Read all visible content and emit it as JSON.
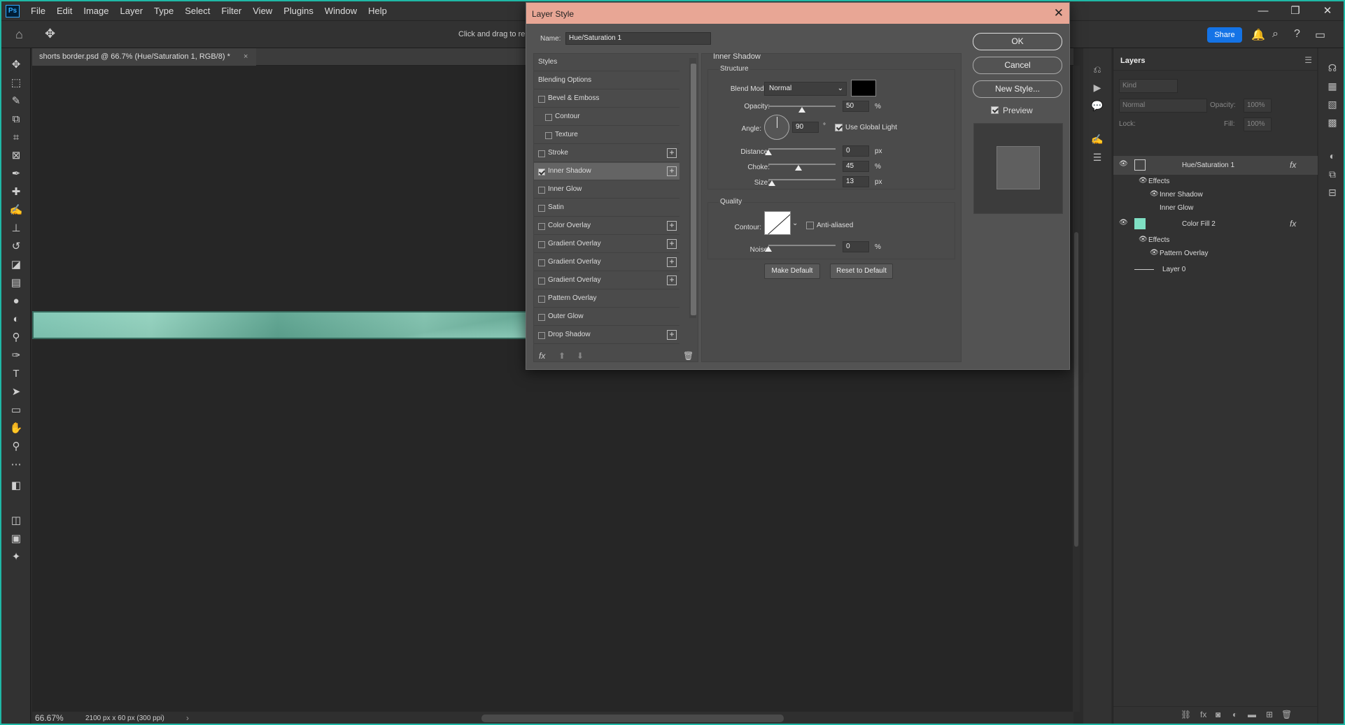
{
  "app": {
    "logo": "Ps"
  },
  "menu": [
    "File",
    "Edit",
    "Image",
    "Layer",
    "Type",
    "Select",
    "Filter",
    "View",
    "Plugins",
    "Window",
    "Help"
  ],
  "window_controls": {
    "minimize": "—",
    "restore": "❐",
    "close": "✕"
  },
  "options_bar": {
    "hint": "Click and drag to rep",
    "share": "Share"
  },
  "document": {
    "tab_title": "shorts border.psd @ 66.7% (Hue/Saturation 1, RGB/8) *",
    "zoom": "66.67%",
    "dimensions": "2100 px x 60 px (300 ppi)"
  },
  "dialog": {
    "title": "Layer Style",
    "name_label": "Name:",
    "name_value": "Hue/Saturation 1",
    "styles": [
      {
        "label": "Styles",
        "checkbox": false,
        "checked": false,
        "plus": false,
        "indent": 0,
        "selected": false
      },
      {
        "label": "Blending Options",
        "checkbox": false,
        "checked": false,
        "plus": false,
        "indent": 0,
        "selected": false
      },
      {
        "label": "Bevel & Emboss",
        "checkbox": true,
        "checked": false,
        "plus": false,
        "indent": 0,
        "selected": false
      },
      {
        "label": "Contour",
        "checkbox": true,
        "checked": false,
        "plus": false,
        "indent": 1,
        "selected": false
      },
      {
        "label": "Texture",
        "checkbox": true,
        "checked": false,
        "plus": false,
        "indent": 1,
        "selected": false
      },
      {
        "label": "Stroke",
        "checkbox": true,
        "checked": false,
        "plus": true,
        "indent": 0,
        "selected": false
      },
      {
        "label": "Inner Shadow",
        "checkbox": true,
        "checked": true,
        "plus": true,
        "indent": 0,
        "selected": true
      },
      {
        "label": "Inner Glow",
        "checkbox": true,
        "checked": false,
        "plus": false,
        "indent": 0,
        "selected": false
      },
      {
        "label": "Satin",
        "checkbox": true,
        "checked": false,
        "plus": false,
        "indent": 0,
        "selected": false
      },
      {
        "label": "Color Overlay",
        "checkbox": true,
        "checked": false,
        "plus": true,
        "indent": 0,
        "selected": false
      },
      {
        "label": "Gradient Overlay",
        "checkbox": true,
        "checked": false,
        "plus": true,
        "indent": 0,
        "selected": false
      },
      {
        "label": "Gradient Overlay",
        "checkbox": true,
        "checked": false,
        "plus": true,
        "indent": 0,
        "selected": false
      },
      {
        "label": "Gradient Overlay",
        "checkbox": true,
        "checked": false,
        "plus": true,
        "indent": 0,
        "selected": false
      },
      {
        "label": "Pattern Overlay",
        "checkbox": true,
        "checked": false,
        "plus": false,
        "indent": 0,
        "selected": false
      },
      {
        "label": "Outer Glow",
        "checkbox": true,
        "checked": false,
        "plus": false,
        "indent": 0,
        "selected": false
      },
      {
        "label": "Drop Shadow",
        "checkbox": true,
        "checked": false,
        "plus": true,
        "indent": 0,
        "selected": false
      }
    ],
    "panel": {
      "title": "Inner Shadow",
      "structure": "Structure",
      "blend_mode_label": "Blend Mode:",
      "blend_mode": "Normal",
      "shadow_color": "#000000",
      "opacity_label": "Opacity:",
      "opacity": "50",
      "opacity_level": 50,
      "angle_label": "Angle:",
      "angle": "90",
      "angle_unit": "°",
      "use_global_light": "Use Global Light",
      "use_global_light_checked": true,
      "distance_label": "Distance:",
      "distance": "0",
      "distance_level": 0,
      "choke_label": "Choke:",
      "choke": "45",
      "choke_level": 45,
      "size_label": "Size:",
      "size": "13",
      "size_level": 5,
      "px": "px",
      "pct": "%",
      "quality": "Quality",
      "contour_label": "Contour:",
      "anti_aliased": "Anti-aliased",
      "anti_aliased_checked": false,
      "noise_label": "Noise:",
      "noise": "0",
      "noise_level": 0,
      "make_default": "Make Default",
      "reset_default": "Reset to Default"
    },
    "buttons": {
      "ok": "OK",
      "cancel": "Cancel",
      "new_style": "New Style..."
    },
    "preview_label": "Preview",
    "preview_checked": true,
    "footer_icons": {
      "fx": "fx",
      "up": "⬆",
      "down": "⬇",
      "trash": "🗑"
    }
  },
  "layers": {
    "title": "Layers",
    "kind": "Kind",
    "blend": "Normal",
    "opacity_label": "Opacity:",
    "opacity": "100%",
    "lock_label": "Lock:",
    "fill_label": "Fill:",
    "fill": "100%",
    "rows": [
      {
        "name": "Hue/Saturation 1",
        "type": "layer",
        "eye": true,
        "fx": "fx",
        "selected": true,
        "thumb": "adjust"
      },
      {
        "name": "Effects",
        "type": "effects",
        "eye": true
      },
      {
        "name": "Inner Shadow",
        "type": "effect",
        "eye": true
      },
      {
        "name": "Inner Glow",
        "type": "effect",
        "eye": false
      },
      {
        "name": "Color Fill 2",
        "type": "layer",
        "eye": true,
        "fx": "fx",
        "selected": false,
        "thumb": "fill"
      },
      {
        "name": "Effects",
        "type": "effects",
        "eye": true
      },
      {
        "name": "Pattern Overlay",
        "type": "effect",
        "eye": true
      },
      {
        "name": "Layer 0",
        "type": "layer",
        "eye": false,
        "selected": false,
        "thumb": "line"
      }
    ]
  }
}
